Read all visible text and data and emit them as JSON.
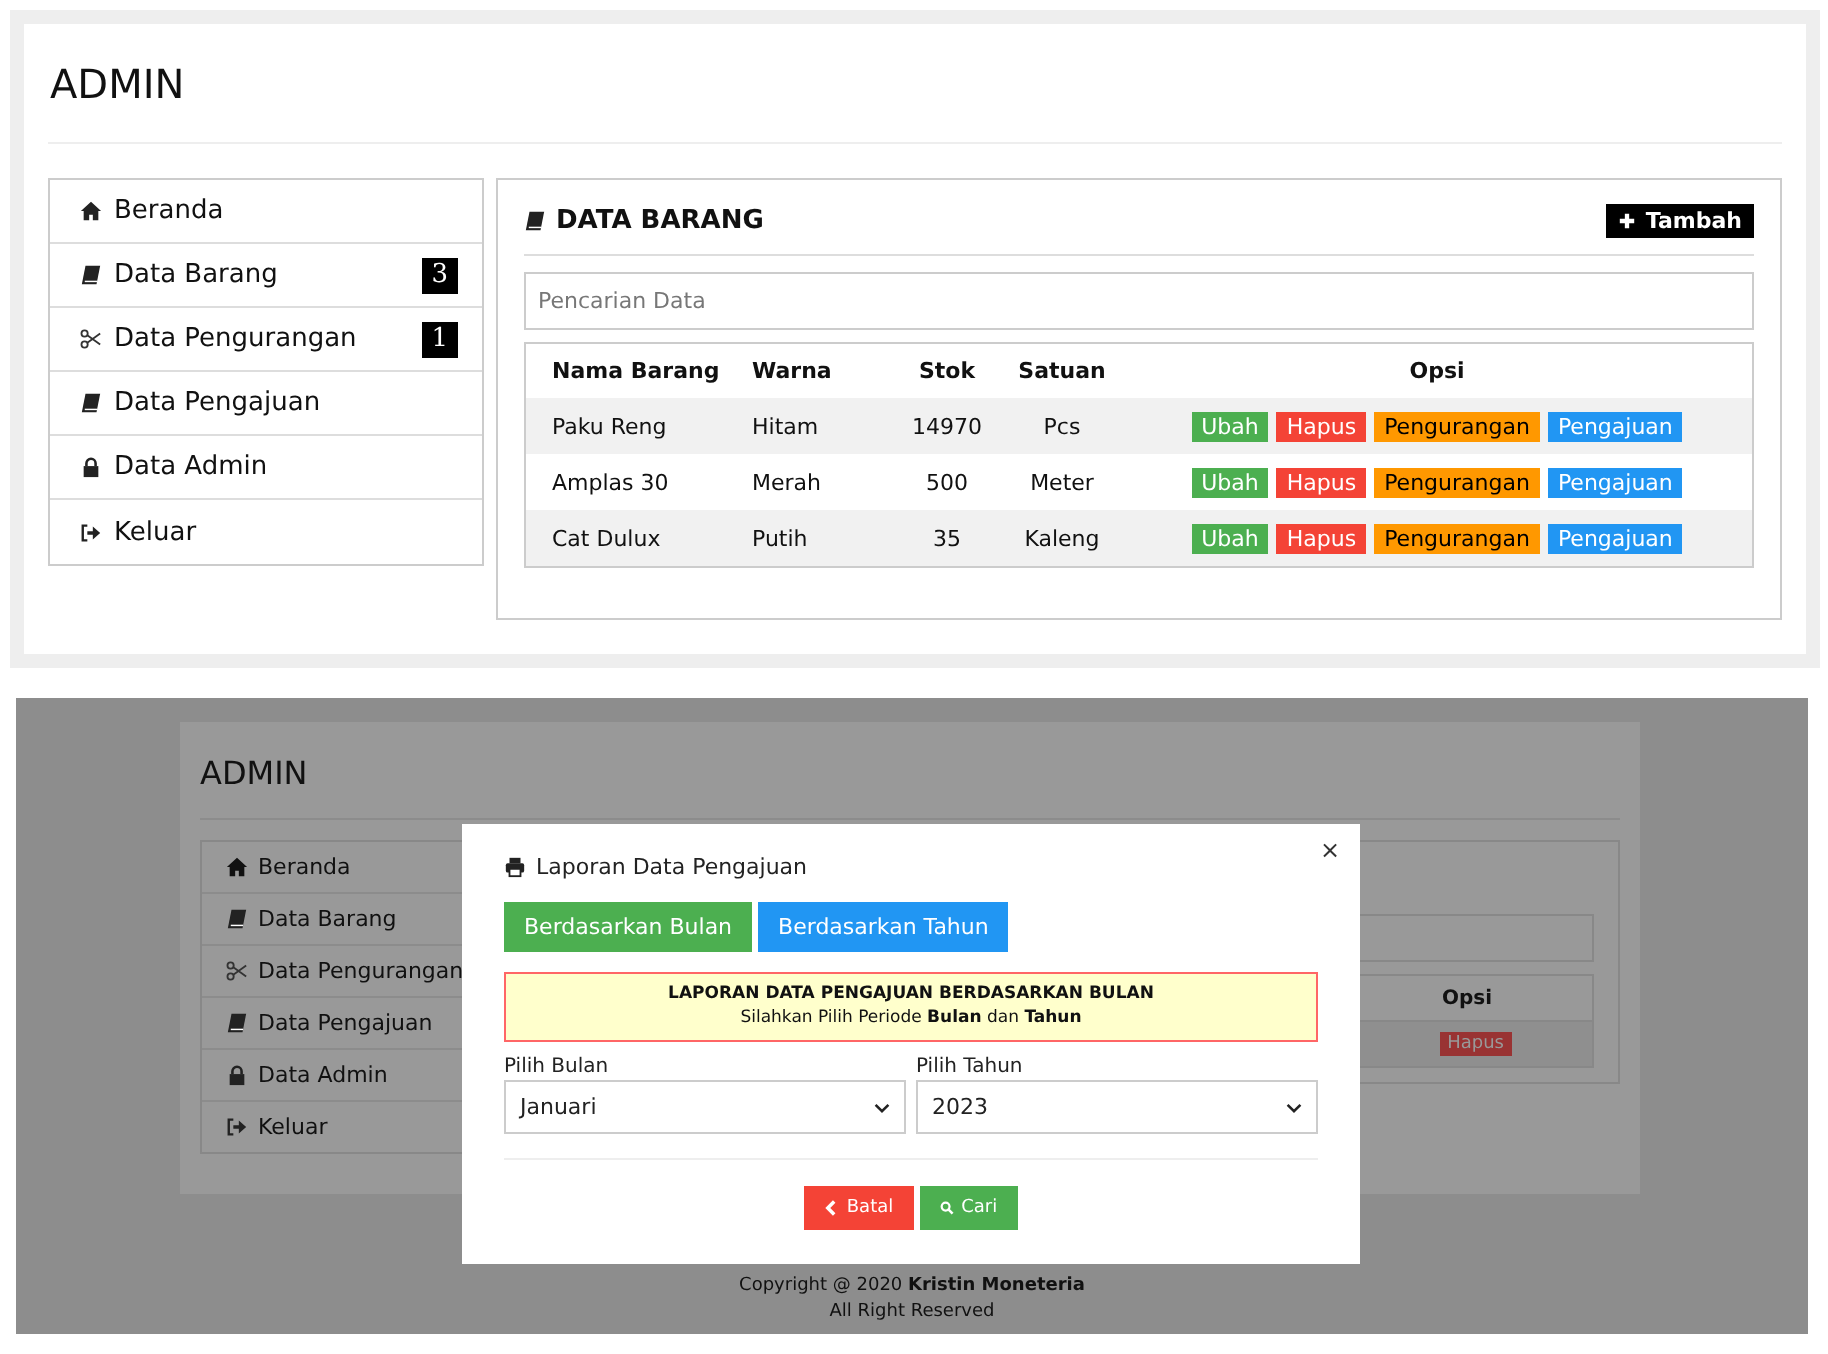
{
  "admin_page": {
    "header": {
      "title": "ADMIN"
    },
    "sidebar": {
      "items": [
        {
          "label": "Beranda"
        },
        {
          "label": "Data Barang",
          "badge": "3"
        },
        {
          "label": "Data Pengurangan",
          "badge": "1"
        },
        {
          "label": "Data Pengajuan"
        },
        {
          "label": "Data Admin"
        },
        {
          "label": "Keluar"
        }
      ]
    },
    "panel": {
      "title": "DATA BARANG",
      "add_button": "Tambah",
      "search": {
        "placeholder": "Pencarian Data"
      },
      "table": {
        "columns": [
          "Nama Barang",
          "Warna",
          "Stok",
          "Satuan",
          "Opsi"
        ],
        "rows": [
          {
            "cells": [
              "Paku Reng",
              "Hitam",
              "14970",
              "Pcs"
            ],
            "actions": [
              {
                "label": "Ubah",
                "kind": "edit"
              },
              {
                "label": "Hapus",
                "kind": "delete"
              },
              {
                "label": "Pengurangan",
                "kind": "reduce"
              },
              {
                "label": "Pengajuan",
                "kind": "request"
              }
            ]
          },
          {
            "cells": [
              "Amplas 30",
              "Merah",
              "500",
              "Meter"
            ],
            "actions": [
              {
                "label": "Ubah",
                "kind": "edit"
              },
              {
                "label": "Hapus",
                "kind": "delete"
              },
              {
                "label": "Pengurangan",
                "kind": "reduce"
              },
              {
                "label": "Pengajuan",
                "kind": "request"
              }
            ]
          },
          {
            "cells": [
              "Cat Dulux",
              "Putih",
              "35",
              "Kaleng"
            ],
            "actions": [
              {
                "label": "Ubah",
                "kind": "edit"
              },
              {
                "label": "Hapus",
                "kind": "delete"
              },
              {
                "label": "Pengurangan",
                "kind": "reduce"
              },
              {
                "label": "Pengajuan",
                "kind": "request"
              }
            ]
          }
        ]
      }
    }
  },
  "dialog_view": {
    "background": {
      "title": "ADMIN",
      "sidebar_items": [
        "Beranda",
        "Data Barang",
        "Data Pengurangan",
        "Data Pengajuan",
        "Data Admin",
        "Keluar"
      ],
      "table_header": "Opsi",
      "row_action": {
        "label": "Hapus",
        "kind": "delete"
      },
      "footer": {
        "copyright": "Copyright @ 2020 **Kristin Moneteria**",
        "rights": "All Right Reserved"
      }
    },
    "modal": {
      "title": "Laporan Data Pengajuan",
      "close": "×",
      "tabs": [
        {
          "label": "Berdasarkan Bulan",
          "selected": true
        },
        {
          "label": "Berdasarkan Tahun",
          "selected": false
        }
      ],
      "notice": {
        "heading": "LAPORAN DATA PENGAJUAN BERDASARKAN BULAN",
        "text": "Silahkan Pilih Periode **Bulan** dan **Tahun**"
      },
      "fields": [
        {
          "label": "Pilih Bulan",
          "value": "Januari"
        },
        {
          "label": "Pilih Tahun",
          "value": "2023"
        }
      ],
      "buttons": [
        {
          "label": "Batal",
          "kind": "cancel"
        },
        {
          "label": "Cari",
          "kind": "search"
        }
      ]
    }
  }
}
